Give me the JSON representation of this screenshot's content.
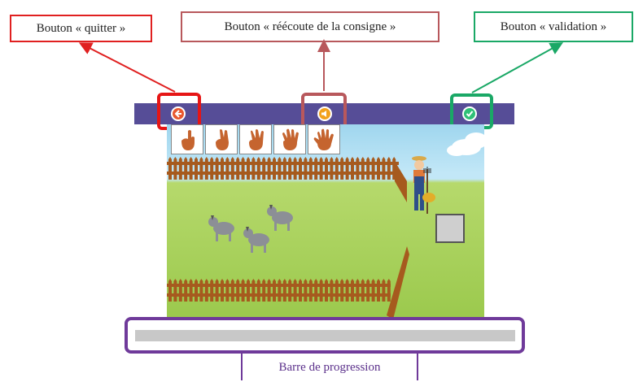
{
  "callouts": {
    "quit": "Bouton « quitter »",
    "replay": "Bouton « réécoute de la consigne »",
    "validate": "Bouton « validation »",
    "progress": "Barre de progression"
  },
  "icons": {
    "quit": "arrow-left-icon",
    "replay": "speaker-icon",
    "validate": "checkmark-icon"
  },
  "colors": {
    "quit_highlight": "#e61515",
    "replay_highlight": "#b8585c",
    "validate_highlight": "#1aa866",
    "progress_highlight": "#6f3a9a",
    "topbar": "#564d97"
  },
  "hand_cards": [
    "one-finger-hand",
    "two-fingers-hand",
    "three-fingers-hand",
    "four-fingers-hand",
    "five-fingers-hand"
  ],
  "progress": {
    "value": 0
  }
}
